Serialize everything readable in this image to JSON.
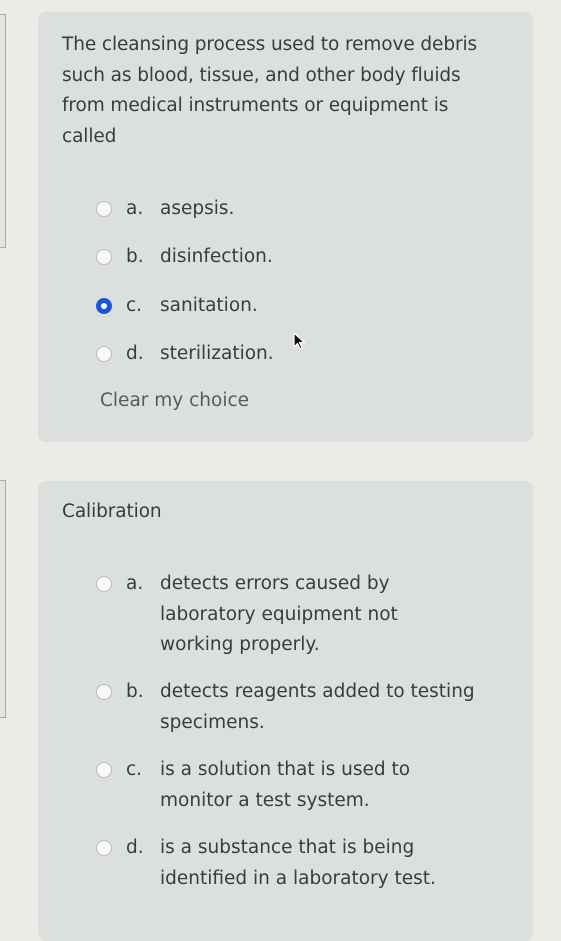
{
  "questions": [
    {
      "text": "The cleansing process used to remove debris such as blood, tissue, and other body fluids from medical instruments or equipment is called",
      "options": [
        {
          "letter": "a.",
          "label": "asepsis.",
          "selected": false
        },
        {
          "letter": "b.",
          "label": "disinfection.",
          "selected": false
        },
        {
          "letter": "c.",
          "label": "sanitation.",
          "selected": true
        },
        {
          "letter": "d.",
          "label": "sterilization.",
          "selected": false
        }
      ],
      "clear_label": "Clear my choice"
    },
    {
      "text": "Calibration",
      "options": [
        {
          "letter": "a.",
          "label": "detects errors caused by laboratory equipment not working properly.",
          "selected": false
        },
        {
          "letter": "b.",
          "label": "detects reagents added to testing specimens.",
          "selected": false
        },
        {
          "letter": "c.",
          "label": "is a solution that is used to monitor a test system.",
          "selected": false
        },
        {
          "letter": "d.",
          "label": "is a substance that is being identified in a laboratory test.",
          "selected": false
        }
      ]
    }
  ],
  "colors": {
    "radio_selected": "#1a56d6",
    "card_bg": "#dbdfdd",
    "page_bg": "#ecebe6"
  },
  "icons": {
    "cursor": "mouse-pointer-icon"
  }
}
